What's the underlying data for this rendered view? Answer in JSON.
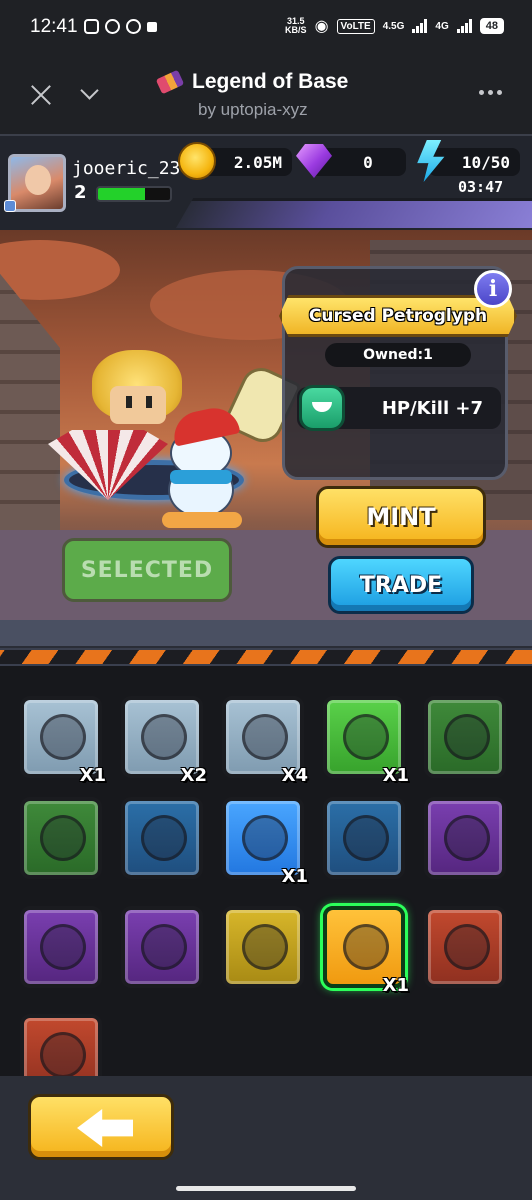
{
  "statusbar": {
    "time": "12:41",
    "speed_value": "31.5",
    "speed_unit": "KB/S",
    "volte": "VoLTE",
    "net1": "4.5G",
    "net2": "4G",
    "battery": "48"
  },
  "header": {
    "title": "Legend of Base",
    "subtitle": "by uptopia-xyz"
  },
  "player": {
    "username": "jooeric_23",
    "level": "2",
    "xp_fraction": 0.65
  },
  "resources": {
    "gold": "2.05M",
    "gems": "0",
    "energy": "10/50",
    "timer": "03:47"
  },
  "scene": {
    "selected_label": "SELECTED"
  },
  "item_info": {
    "name": "Cursed Petroglyph",
    "owned": "Owned:1",
    "stat": "HP/Kill +7",
    "info_label": "i"
  },
  "actions": {
    "mint_label": "MINT",
    "trade_label": "TRADE"
  },
  "inventory": {
    "slots": [
      {
        "icon": "bone-ring-icon",
        "rarity": "gray",
        "count": "X1"
      },
      {
        "icon": "crown-icon",
        "rarity": "gray",
        "count": "X2"
      },
      {
        "icon": "pendant-icon",
        "rarity": "gray",
        "count": "X4"
      },
      {
        "icon": "gear-amulet-icon",
        "rarity": "green",
        "count": "X1"
      },
      {
        "icon": "orb-icon",
        "rarity": "dgreen",
        "count": ""
      },
      {
        "icon": "compass-icon",
        "rarity": "dgreen",
        "count": ""
      },
      {
        "icon": "horn-icon",
        "rarity": "blue",
        "count": ""
      },
      {
        "icon": "bow-icon",
        "rarity": "lblue",
        "count": "X1"
      },
      {
        "icon": "bracelet-icon",
        "rarity": "blue",
        "count": ""
      },
      {
        "icon": "bell-icon",
        "rarity": "purple",
        "count": ""
      },
      {
        "icon": "shield-sigil-icon",
        "rarity": "purple",
        "count": ""
      },
      {
        "icon": "mirror-icon",
        "rarity": "purple",
        "count": ""
      },
      {
        "icon": "totem-icon",
        "rarity": "yellow",
        "count": ""
      },
      {
        "icon": "petroglyph-icon",
        "rarity": "orange",
        "count": "X1"
      },
      {
        "icon": "anvil-icon",
        "rarity": "red",
        "count": ""
      },
      {
        "icon": "pouch-icon",
        "rarity": "red",
        "count": ""
      }
    ]
  }
}
